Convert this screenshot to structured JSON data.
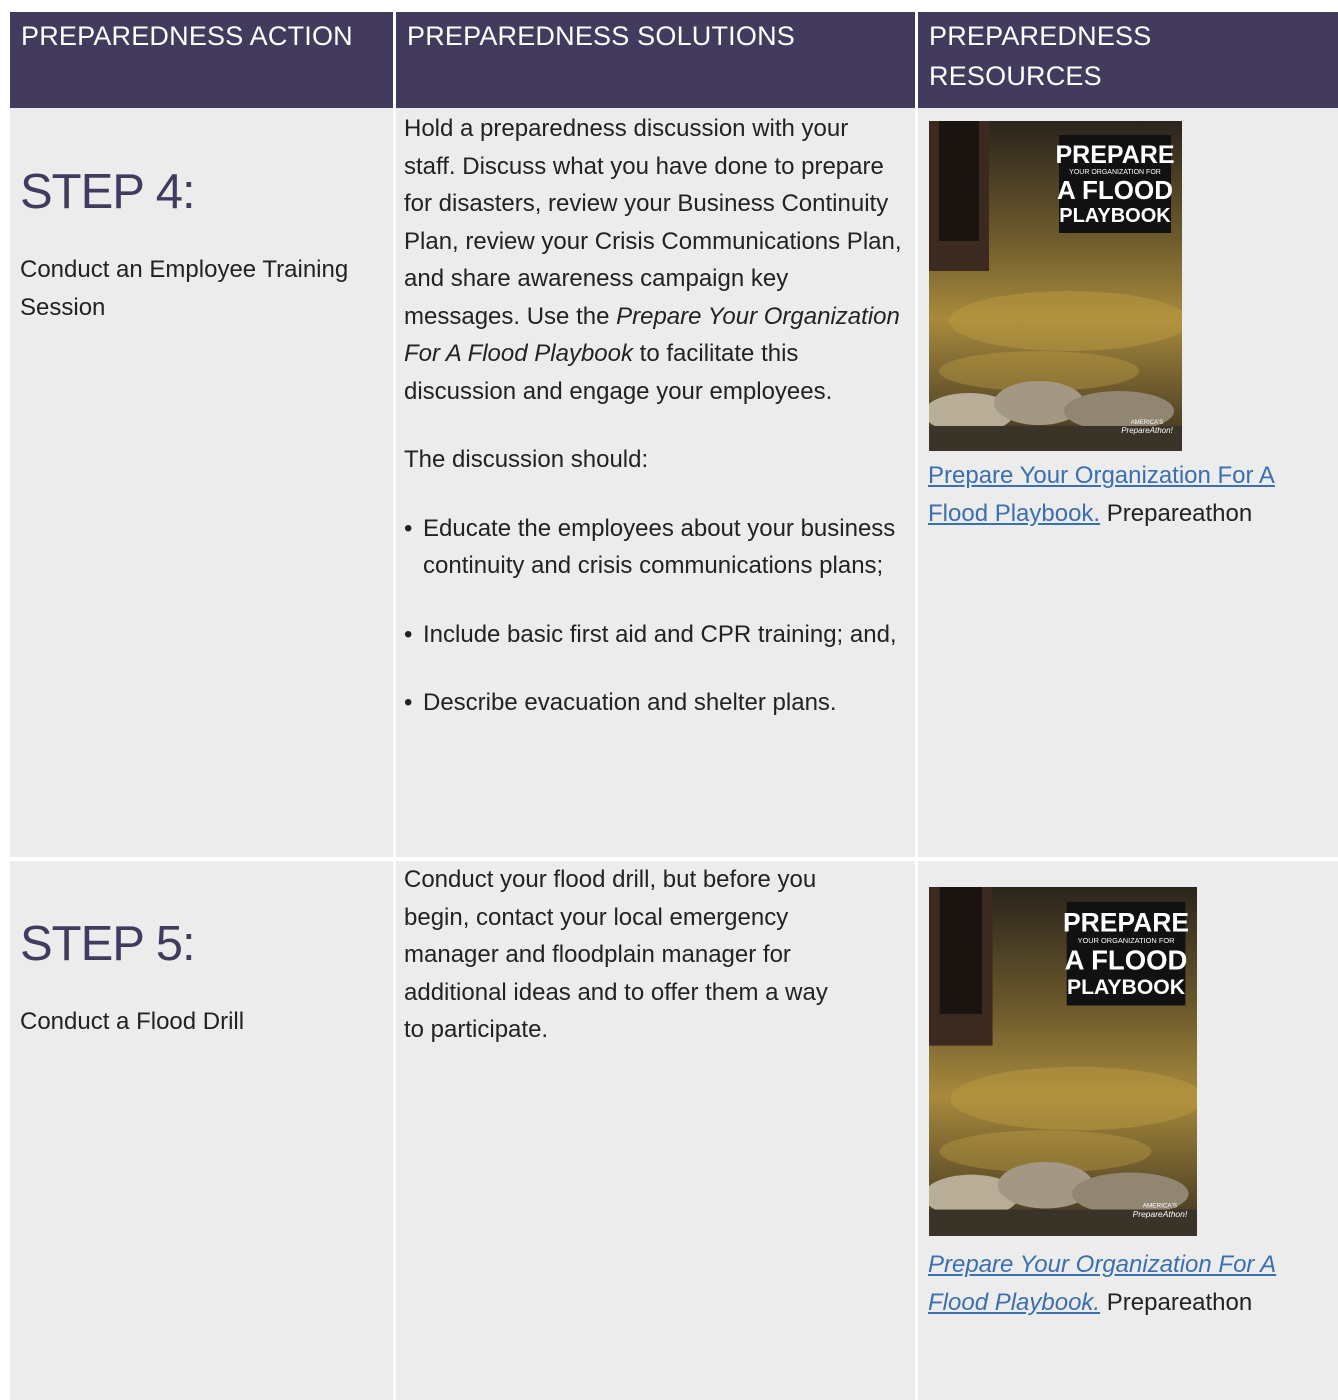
{
  "headers": {
    "action": "PREPAREDNESS ACTION",
    "solutions": "PREPAREDNESS SOLUTIONS",
    "resources": "PREPAREDNESS RESOURCES"
  },
  "rows": [
    {
      "step": "STEP 4:",
      "action": "Conduct an Employee Training Session",
      "solution_intro_1": "Hold a preparedness discussion with your staff. Discuss what you have done to prepare for disasters, review your Business Continuity Plan, review your Crisis Communications Plan, and share awareness campaign key messages. Use the ",
      "solution_intro_italic": "Prepare Your Organization For A Flood Playbook",
      "solution_intro_2": " to facilitate this discussion and engage your employees.",
      "solution_lead": "The discussion should:",
      "bullets": [
        "Educate the employees about your business continuity and crisis communications plans;",
        "Include basic first aid and CPR training; and,",
        "Describe evacuation and shelter plans."
      ],
      "resource_link": "Prepare Your Organization For A Flood Playbook.",
      "resource_source": " Prepareathon",
      "cover": {
        "title_1": "PREPARE",
        "subtitle": "YOUR ORGANIZATION FOR",
        "title_2": "A FLOOD",
        "title_3": "PLAYBOOK",
        "brand_1": "AMERICA'S",
        "brand_2": "PrepareAthon!"
      }
    },
    {
      "step": "STEP 5:",
      "action": "Conduct a Flood Drill",
      "solution": "Conduct your flood drill, but before you begin, contact your local emergency manager and floodplain manager for additional ideas and to offer them a way to participate.",
      "resource_link": "Prepare Your Organization For A Flood Playbook.",
      "resource_source": " Prepareathon",
      "cover": {
        "title_1": "PREPARE",
        "subtitle": "YOUR ORGANIZATION FOR",
        "title_2": "A FLOOD",
        "title_3": "PLAYBOOK",
        "brand_1": "AMERICA'S",
        "brand_2": "PrepareAthon!"
      }
    }
  ],
  "colors": {
    "header_bg": "#433b5e",
    "cell_bg": "#ececec",
    "step_text": "#433b5e",
    "link": "#3a6fb0"
  }
}
